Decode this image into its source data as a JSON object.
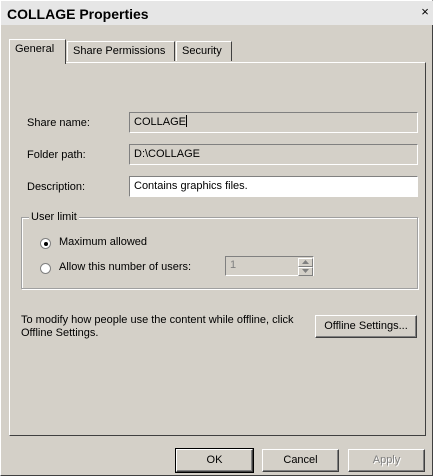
{
  "window": {
    "title": "COLLAGE Properties",
    "close_glyph": "×"
  },
  "tabs": [
    {
      "label": "General",
      "active": true
    },
    {
      "label": "Share Permissions",
      "active": false
    },
    {
      "label": "Security",
      "active": false
    }
  ],
  "general": {
    "share_name": {
      "label": "Share name:",
      "value": "COLLAGE"
    },
    "folder_path": {
      "label": "Folder path:",
      "value": "D:\\COLLAGE"
    },
    "description": {
      "label": "Description:",
      "value": "Contains graphics files."
    },
    "user_limit": {
      "title": "User limit",
      "max_allowed_label": "Maximum allowed",
      "allow_number_label": "Allow this number of users:",
      "selected": "Maximum allowed",
      "number_value": "1"
    },
    "offline": {
      "text": "To modify how people use the content while offline, click Offline Settings.",
      "button_label": "Offline Settings..."
    }
  },
  "footer": {
    "ok": "OK",
    "cancel": "Cancel",
    "apply": "Apply"
  }
}
